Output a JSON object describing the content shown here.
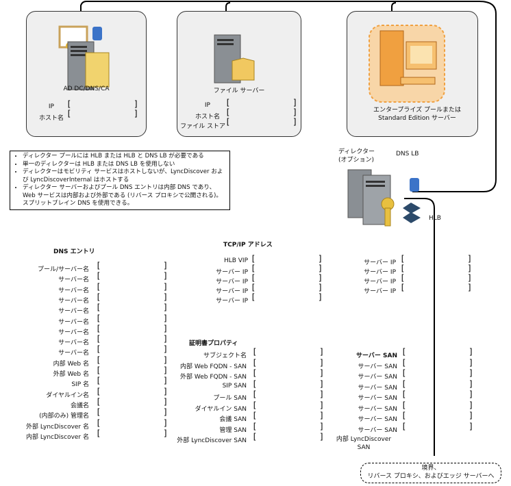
{
  "servers": {
    "ad": {
      "title": "AD DC/DNS/CA",
      "ip_label": "IP",
      "host_label": "ホスト名"
    },
    "file": {
      "title": "ファイル サーバー",
      "ip_label": "IP",
      "host_label": "ホスト名",
      "store_label": "ファイル ストア"
    },
    "enterprise": {
      "title": "エンタープライズ プールまたは Standard Edition サーバー"
    }
  },
  "director": {
    "title": "ディレクター\n(オプション)",
    "dns_lb": "DNS LB",
    "hlb": "HLB"
  },
  "notes": [
    "ディレクター プールには HLB または HLB と DNS LB が必要である",
    "単一のディレクターは HLB または DNS LB を使用しない",
    "ディレクターはモビリティ サービスはホストしないが、LyncDiscover および LyncDiscoverInternal はホストする",
    "ディレクター サーバーおよびプール DNS エントリは内部 DNS であり、Web サービスは内部および外部である (リバース プロキシで公開される)。スプリットブレイン DNS を使用できる。"
  ],
  "dns": {
    "heading": "DNS エントリ",
    "rows": [
      "プール/サーバー名",
      "サーバー名",
      "サーバー名",
      "サーバー名",
      "サーバー名",
      "サーバー名",
      "サーバー名",
      "サーバー名",
      "サーバー名",
      "内部 Web 名",
      "外部 Web 名",
      "SIP 名",
      "ダイヤルイン名",
      "会議名",
      "(内部のみ) 管理名",
      "外部 LyncDiscover 名",
      "内部 LyncDiscover 名"
    ]
  },
  "tcpip": {
    "heading": "TCP/IP アドレス",
    "left": [
      "HLB VIP",
      "サーバー IP",
      "サーバー IP",
      "サーバー IP",
      "サーバー IP"
    ],
    "right": [
      "サーバー IP",
      "サーバー IP",
      "サーバー IP",
      "サーバー IP"
    ]
  },
  "cert": {
    "heading": "証明書プロパティ",
    "left": [
      "サブジェクト名",
      "内部 Web FQDN - SAN",
      "外部 Web FQDN - SAN",
      "SIP SAN",
      "プール SAN",
      "ダイヤルイン SAN",
      "会議 SAN",
      "管理 SAN",
      "外部 LyncDiscover SAN"
    ],
    "right_head": "サーバー SAN",
    "right": [
      "サーバー SAN",
      "サーバー SAN",
      "サーバー SAN",
      "サーバー SAN",
      "サーバー SAN",
      "サーバー SAN",
      "サーバー SAN"
    ],
    "right_last": "内部 LyncDiscover SAN"
  },
  "perimeter": "境界、\nリバース プロキシ、およびエッジ サーバーへ",
  "colors": {
    "panel": "#efefef",
    "orange": "#f0a040",
    "key": "#e8c040",
    "hlb": "#2c4a6a"
  }
}
